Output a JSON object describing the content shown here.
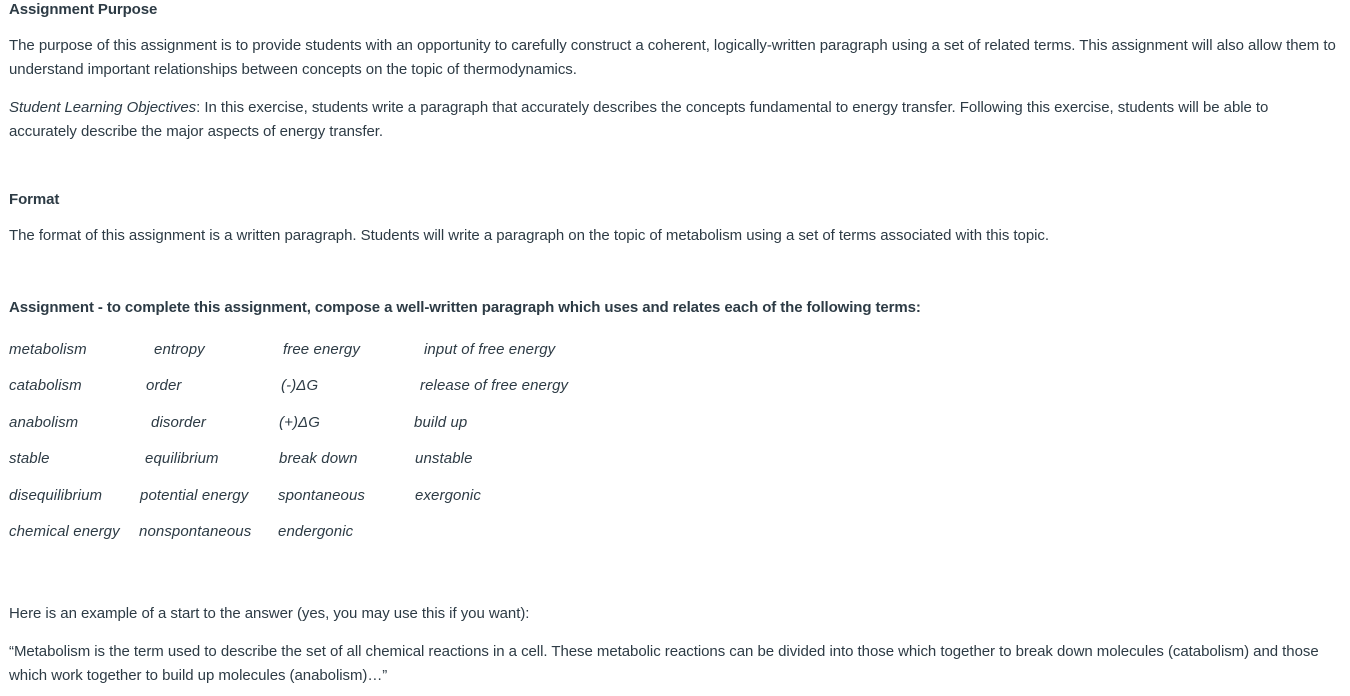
{
  "document": {
    "text_color": "#2d3b45",
    "background_color": "#ffffff"
  },
  "purpose": {
    "heading": "Assignment Purpose",
    "paragraph": "The purpose of this assignment is to provide students with an opportunity to carefully construct a coherent, logically-written paragraph using a set of related terms. This assignment will also allow them to understand important relationships between concepts on the topic of thermodynamics.",
    "objectives_label": "Student Learning Objectives",
    "objectives_text": ": In this exercise, students write a paragraph that accurately describes the concepts fundamental to energy transfer. Following this exercise, students will be able to accurately describe the major aspects of energy transfer."
  },
  "format": {
    "heading": "Format",
    "paragraph": "The format of this assignment is a written paragraph. Students will write a paragraph on the topic of metabolism using a set of terms associated with this topic."
  },
  "assignment": {
    "instruction": "Assignment - to complete this assignment, compose a well-written paragraph which uses and relates each of the following terms:",
    "terms_rows": [
      [
        "metabolism",
        "entropy",
        "free energy",
        "input of free energy"
      ],
      [
        "catabolism",
        "order",
        "(-)ΔG",
        "release of free energy"
      ],
      [
        "anabolism",
        "disorder",
        "(+)ΔG",
        "build up"
      ],
      [
        "stable",
        "equilibrium",
        "break down",
        "unstable"
      ],
      [
        "disequilibrium",
        "potential energy",
        "spontaneous",
        "exergonic"
      ],
      [
        "chemical energy",
        "nonspontaneous",
        "endergonic",
        ""
      ]
    ]
  },
  "example": {
    "intro": "Here is an example of a start to the answer (yes, you may use this if you want):",
    "quote": "“Metabolism is the term used to describe the set of all chemical reactions in a cell. These metabolic reactions can be divided into those which together to break down molecules (catabolism) and those which work together to build up molecules (anabolism)…”"
  }
}
